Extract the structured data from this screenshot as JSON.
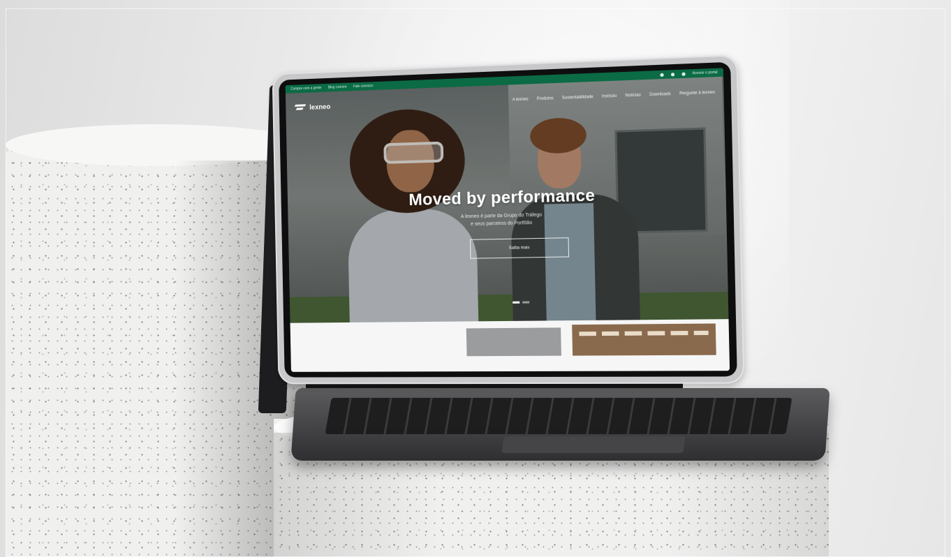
{
  "site": {
    "brand": "lexneo",
    "topbar": {
      "links": [
        "Compre com a gente",
        "Blog Lexneo",
        "Fale conosco"
      ],
      "right_label": "Acesse o portal"
    },
    "nav": {
      "items": [
        "A lexneo",
        "Produtos",
        "Sustentabilidade",
        "Instituto",
        "Notícias",
        "Downloads",
        "Pergunte à lexneo"
      ]
    },
    "hero": {
      "title": "Moved by performance",
      "subtitle_line1": "A lexneo é parte da Grupo do Tráfego",
      "subtitle_line2": "e seus parceiros do Portfólio",
      "button_label": "Saiba mais"
    }
  },
  "colors": {
    "topbar": "#0b6b45",
    "tablet_frame": "#c8c8ca",
    "pedestal": "#f0f0ef"
  }
}
